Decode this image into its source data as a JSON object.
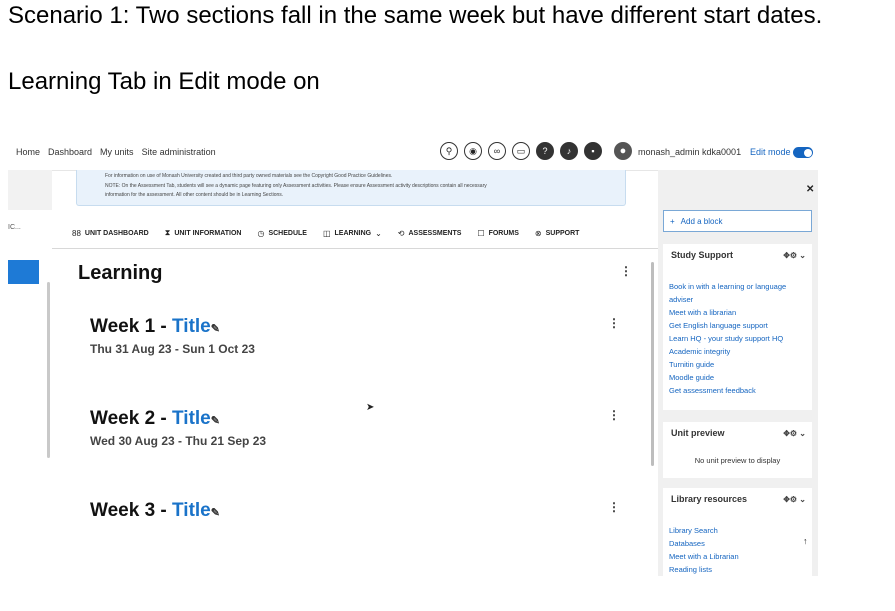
{
  "headings": {
    "scenario": "Scenario 1: Two sections fall in the same week but have different start dates.",
    "mode": "Learning Tab in Edit mode on"
  },
  "topnav": {
    "links": [
      "Home",
      "Dashboard",
      "My units",
      "Site administration"
    ],
    "username": "monash_admin kdka0001",
    "edit_mode_label": "Edit mode",
    "edit_mode_on": true,
    "icons": [
      "search-icon",
      "accessibility-icon",
      "link-icon",
      "book-icon",
      "help-icon",
      "bell-icon",
      "chat-icon"
    ]
  },
  "drawer": {
    "truncated_text": "IC..."
  },
  "notice": {
    "line1": "For information on use of Monash University created and third party owned materials see the Copyright Good Practice Guidelines.",
    "line2": "NOTE: On the Assessment Tab, students will see a dynamic page featuring only Assessment activities. Please ensure Assessment activity descriptions contain all necessary",
    "line3": "information for the assessment. All other content should be in Learning Sections."
  },
  "unit_tabs": [
    {
      "label": "UNIT DASHBOARD",
      "icon": "grid-icon",
      "glyph": "88"
    },
    {
      "label": "UNIT INFORMATION",
      "icon": "hourglass-icon",
      "glyph": "⧗"
    },
    {
      "label": "SCHEDULE",
      "icon": "clock-icon",
      "glyph": "◷"
    },
    {
      "label": "LEARNING",
      "icon": "book-icon",
      "glyph": "◫",
      "has_dropdown": true
    },
    {
      "label": "ASSESSMENTS",
      "icon": "assessment-icon",
      "glyph": "⟲"
    },
    {
      "label": "FORUMS",
      "icon": "forum-icon",
      "glyph": "☐"
    },
    {
      "label": "SUPPORT",
      "icon": "support-icon",
      "glyph": "⊗"
    }
  ],
  "main": {
    "title": "Learning",
    "weeks": [
      {
        "label": "Week 1 - ",
        "title": "Title",
        "dates": "Thu 31 Aug 23 - Sun 1 Oct 23"
      },
      {
        "label": "Week 2 - ",
        "title": "Title",
        "dates": "Wed 30 Aug 23 - Thu 21 Sep 23"
      },
      {
        "label": "Week 3 - ",
        "title": "Title",
        "dates": ""
      }
    ]
  },
  "right_drawer": {
    "add_block": "Add a block",
    "study_support": {
      "title": "Study Support",
      "links": [
        "Book in with a learning or language",
        "adviser",
        "Meet with a librarian",
        "Get English language support",
        "Learn HQ - your study support HQ",
        "Academic integrity",
        "Turnitin guide",
        "Moodle guide",
        "Get assessment feedback"
      ]
    },
    "unit_preview": {
      "title": "Unit preview",
      "empty": "No unit preview to display"
    },
    "library": {
      "title": "Library resources",
      "links": [
        "Library Search",
        "Databases",
        "Meet with a Librarian",
        "Reading lists"
      ]
    }
  }
}
